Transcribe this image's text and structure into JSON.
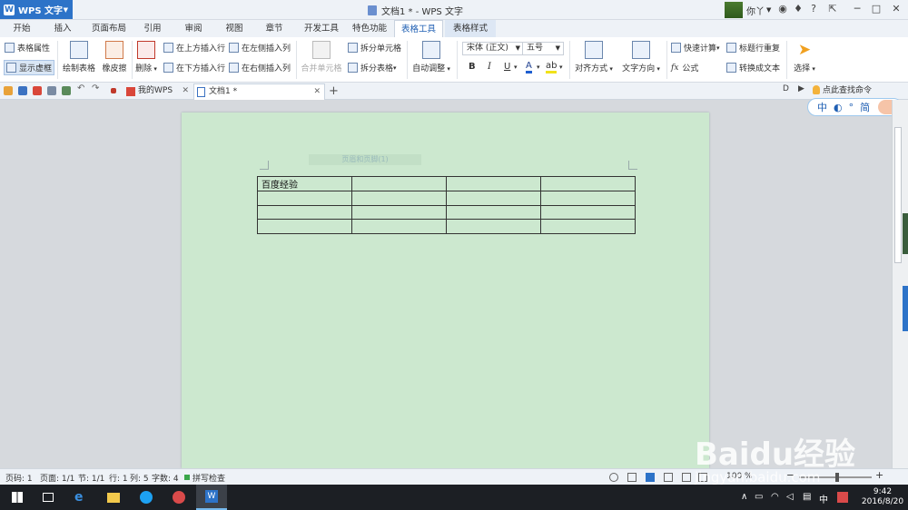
{
  "app": {
    "menu_label": "WPS 文字",
    "window_title": "文档1 * - WPS 文字",
    "user_name": "你丫"
  },
  "ribbon_tabs": [
    "开始",
    "插入",
    "页面布局",
    "引用",
    "审阅",
    "视图",
    "章节",
    "开发工具",
    "特色功能",
    "表格工具",
    "表格样式"
  ],
  "active_tab": "表格工具",
  "ribbon": {
    "table_properties": "表格属性",
    "show_gridlines": "显示虚框",
    "draw_table": "绘制表格",
    "eraser": "橡皮擦",
    "delete": "删除",
    "insert_above": "在上方插入行",
    "insert_below": "在下方插入行",
    "insert_left": "在左侧插入列",
    "insert_right": "在右侧插入列",
    "merge_cells": "合并单元格",
    "split_cells": "拆分单元格",
    "split_table": "拆分表格",
    "auto_fit": "自动调整",
    "font_name": "宋体 (正文)",
    "font_size": "五号",
    "bold": "B",
    "italic": "I",
    "underline": "U",
    "font_color": "A",
    "align": "对齐方式",
    "text_direction": "文字方向",
    "quick_calc": "快速计算",
    "formula": "公式",
    "fx": "fx",
    "repeat_header": "标题行重复",
    "convert_to_text": "转换成文本",
    "select": "选择"
  },
  "doc_tabs": [
    {
      "label": "我的WPS",
      "active": false
    },
    {
      "label": "文档1 *",
      "active": true
    }
  ],
  "find_command": "点此查找命令",
  "ime": {
    "lang": "中",
    "simplified": "简"
  },
  "document": {
    "header_hint": "页眉和页脚(1)",
    "table": [
      [
        "百度经验",
        "",
        "",
        ""
      ],
      [
        "",
        "",
        "",
        ""
      ],
      [
        "",
        "",
        "",
        ""
      ],
      [
        "",
        "",
        "",
        ""
      ]
    ]
  },
  "status": {
    "page": "页码: 1",
    "pages": "页面: 1/1",
    "section": "节: 1/1",
    "row": "行: 1",
    "col": "列: 5",
    "words": "字数: 4",
    "spell": "拼写检查",
    "zoom": "100 %"
  },
  "watermark": {
    "brand": "Baidu经验",
    "url": "jingyan.baidu.com"
  },
  "taskbar": {
    "time": "9:42",
    "date": "2016/8/20",
    "ime": "中"
  }
}
